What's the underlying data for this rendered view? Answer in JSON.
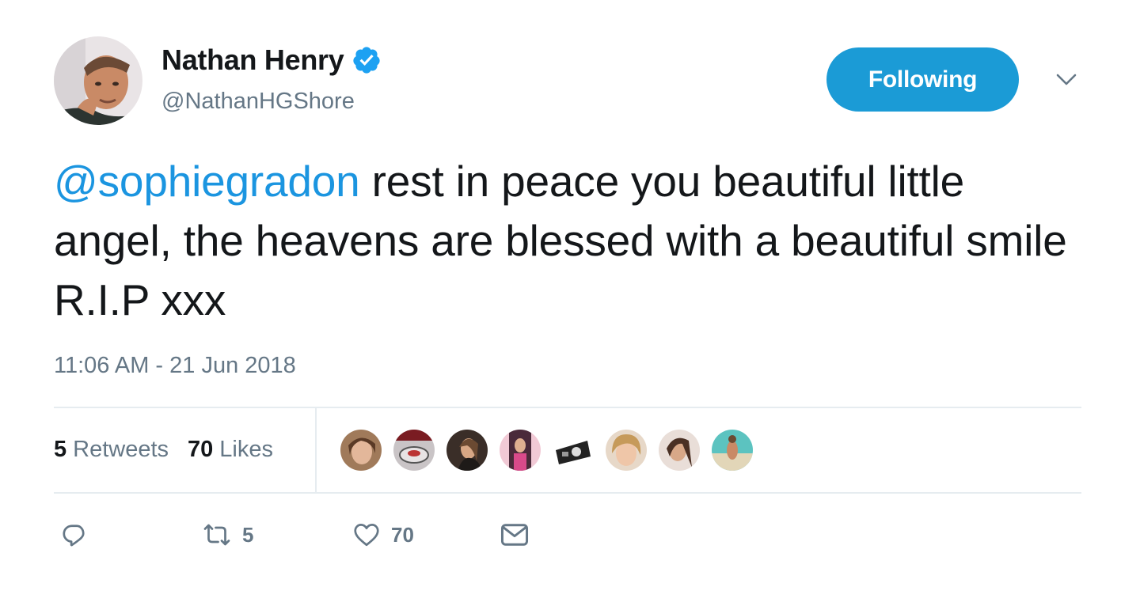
{
  "author": {
    "display_name": "Nathan Henry",
    "handle": "@NathanHGShore",
    "verified": true
  },
  "follow_button": {
    "label": "Following"
  },
  "tweet": {
    "mention": "@sophiegradon",
    "text": " rest in peace you beautiful little angel, the heavens are blessed with a beautiful smile R.I.P xxx",
    "timestamp": "11:06 AM - 21 Jun 2018"
  },
  "stats": {
    "retweets_count": "5",
    "retweets_label": "Retweets",
    "likes_count": "70",
    "likes_label": "Likes"
  },
  "actions": {
    "reply_icon": "reply-icon",
    "retweet_icon": "retweet-icon",
    "retweet_count": "5",
    "like_icon": "heart-icon",
    "like_count": "70",
    "dm_icon": "envelope-icon"
  },
  "colors": {
    "accent": "#1b9bd6",
    "mention": "#1b95e0",
    "muted": "#657786",
    "text": "#14171a"
  }
}
